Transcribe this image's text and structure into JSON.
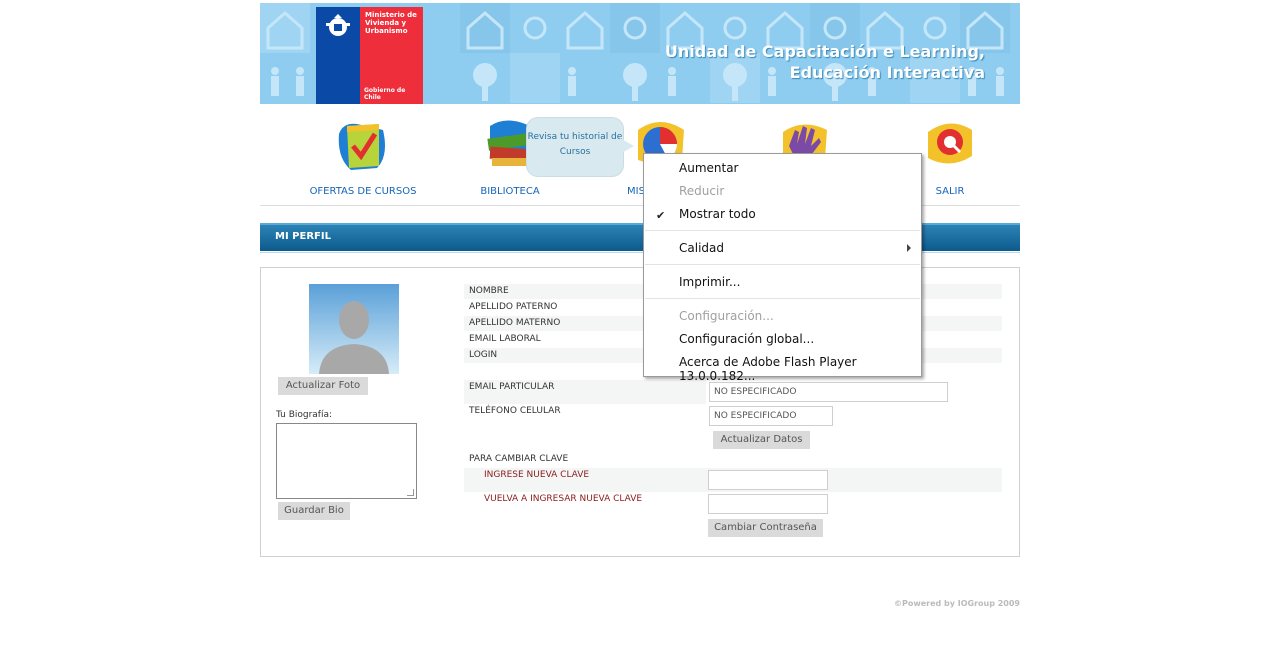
{
  "banner": {
    "ministry": "Ministerio de Vivienda y Urbanismo",
    "government": "Gobierno de Chile",
    "title_line1": "Unidad de Capacitación e Learning,",
    "title_line2": "Educación Interactiva"
  },
  "nav": {
    "items": [
      {
        "label": "OFERTAS DE CURSOS",
        "icon": "notepad-check-icon"
      },
      {
        "label": "BIBLIOTECA",
        "icon": "books-icon"
      },
      {
        "label": "MIS",
        "icon": "pie-chart-icon"
      },
      {
        "label": "",
        "icon": "hand-icon"
      },
      {
        "label": "SALIR",
        "icon": "exit-icon"
      }
    ],
    "tooltip": "Revisa tu historial de Cursos"
  },
  "section": {
    "title": "MI PERFIL"
  },
  "profile": {
    "update_photo": "Actualizar Foto",
    "bio_label": "Tu Biografía:",
    "save_bio": "Guardar Bio",
    "fields": {
      "nombre": "NOMBRE",
      "apellido_paterno": "APELLIDO PATERNO",
      "apellido_materno": "APELLIDO MATERNO",
      "email_laboral": "EMAIL LABORAL",
      "login": "LOGIN",
      "email_particular": "EMAIL PARTICULAR",
      "telefono_celular": "TELÉFONO CELULAR"
    },
    "email_particular_value": "NO ESPECIFICADO",
    "telefono_value": "NO ESPECIFICADO",
    "update_data": "Actualizar Datos",
    "change_password_title": "PARA CAMBIAR CLAVE",
    "new_password_label": "INGRESE NUEVA CLAVE",
    "repeat_password_label": "VUELVA A INGRESAR NUEVA CLAVE",
    "change_password_button": "Cambiar Contraseña"
  },
  "footer": "©Powered by IOGroup 2009",
  "context_menu": {
    "items": [
      {
        "label": "Aumentar",
        "enabled": true
      },
      {
        "label": "Reducir",
        "enabled": false
      },
      {
        "label": "Mostrar todo",
        "enabled": true,
        "checked": true
      },
      {
        "label": "Calidad",
        "enabled": true,
        "submenu": true
      },
      {
        "label": "Imprimir...",
        "enabled": true
      },
      {
        "label": "Configuración...",
        "enabled": false
      },
      {
        "label": "Configuración global...",
        "enabled": true
      },
      {
        "label": "Acerca de Adobe Flash Player 13.0.0.182...",
        "enabled": true
      }
    ]
  },
  "colors": {
    "accent": "#1565b8",
    "section_bar": "#1a6fa3",
    "banner": "#8ecdf0"
  }
}
